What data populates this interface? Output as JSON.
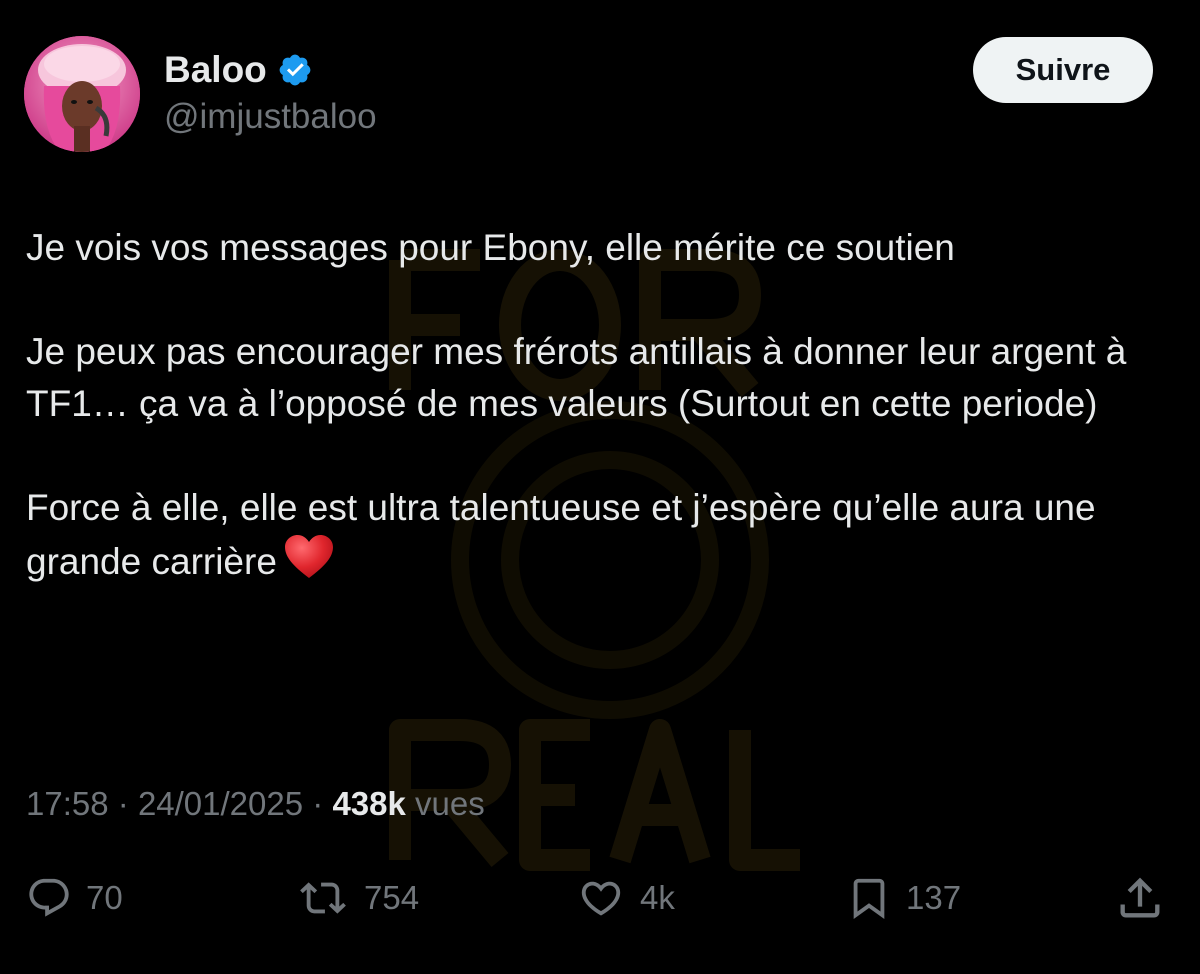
{
  "user": {
    "display_name": "Baloo",
    "handle": "@imjustbaloo",
    "verified": true
  },
  "follow_button": {
    "label": "Suivre"
  },
  "tweet": {
    "paragraphs": [
      "Je vois vos messages pour Ebony, elle mérite ce soutien",
      "Je peux pas encourager mes frérots antillais à donner leur argent à TF1… ça va à l’opposé de mes valeurs (Surtout en cette periode)",
      "Force à elle, elle est ultra talentueuse et j’espère qu’elle aura une grande carrière"
    ],
    "time": "17:58",
    "date": "24/01/2025",
    "separator": "·",
    "views_count": "438k",
    "views_label": "vues"
  },
  "actions": {
    "replies": "70",
    "reposts": "754",
    "likes": "4k",
    "bookmarks": "137"
  },
  "icons": {
    "reply": "reply-icon",
    "repost": "repost-icon",
    "like": "heart-icon",
    "bookmark": "bookmark-icon",
    "share": "share-icon",
    "verified": "verified-badge-icon",
    "emoji": "red-heart-emoji"
  },
  "colors": {
    "background": "#000000",
    "text": "#e7e9ea",
    "secondary": "#71767b",
    "verified": "#1d9bf0",
    "button_bg": "#eff3f4",
    "heart_emoji": "#e0262d"
  }
}
